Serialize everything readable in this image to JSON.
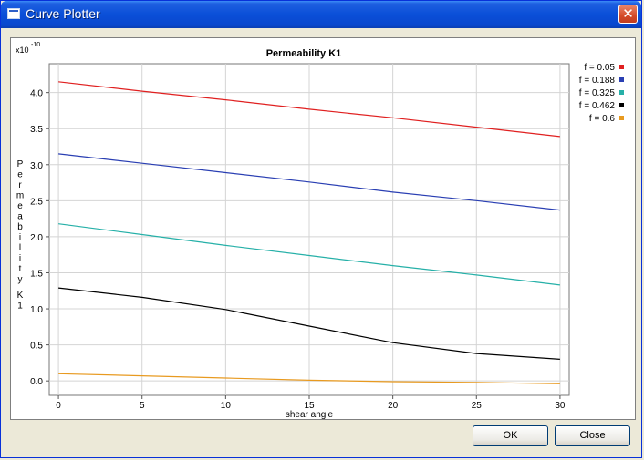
{
  "window": {
    "title": "Curve Plotter",
    "close_glyph": "✕"
  },
  "buttons": {
    "ok_label": "OK",
    "close_label": "Close"
  },
  "chart_data": {
    "type": "line",
    "title": "Permeability K1",
    "xlabel": "shear angle",
    "ylabel": "Permeability K1",
    "yscale_base": "x10",
    "yscale_exp": "-10",
    "xlim": [
      0,
      30
    ],
    "ylim": [
      -0.2,
      4.4
    ],
    "xticks": [
      0,
      5,
      10,
      15,
      20,
      25,
      30
    ],
    "xtick_labels": [
      "0",
      "5",
      "10",
      "15",
      "20",
      "25",
      "30"
    ],
    "yticks": [
      0,
      0.5,
      1,
      1.5,
      2,
      2.5,
      3,
      3.5,
      4
    ],
    "ytick_labels": [
      "0.0",
      "0.5",
      "1.0",
      "1.5",
      "2.0",
      "2.5",
      "3.0",
      "3.5",
      "4.0"
    ],
    "grid": true,
    "legend_position": "right",
    "x": [
      0,
      5,
      10,
      15,
      20,
      25,
      30
    ],
    "series": [
      {
        "name": "f = 0.05",
        "color": "#e02020",
        "values": [
          4.15,
          4.02,
          3.9,
          3.77,
          3.65,
          3.52,
          3.39
        ]
      },
      {
        "name": "f = 0.188",
        "color": "#2a3fb3",
        "values": [
          3.15,
          3.02,
          2.89,
          2.76,
          2.62,
          2.5,
          2.37
        ]
      },
      {
        "name": "f = 0.325",
        "color": "#26b0a8",
        "values": [
          2.18,
          2.03,
          1.88,
          1.74,
          1.6,
          1.47,
          1.33
        ]
      },
      {
        "name": "f = 0.462",
        "color": "#000000",
        "values": [
          1.29,
          1.16,
          0.99,
          0.76,
          0.53,
          0.38,
          0.3
        ]
      },
      {
        "name": "f = 0.6",
        "color": "#e89a20",
        "values": [
          0.1,
          0.07,
          0.04,
          0.01,
          -0.01,
          -0.02,
          -0.04
        ]
      }
    ]
  }
}
